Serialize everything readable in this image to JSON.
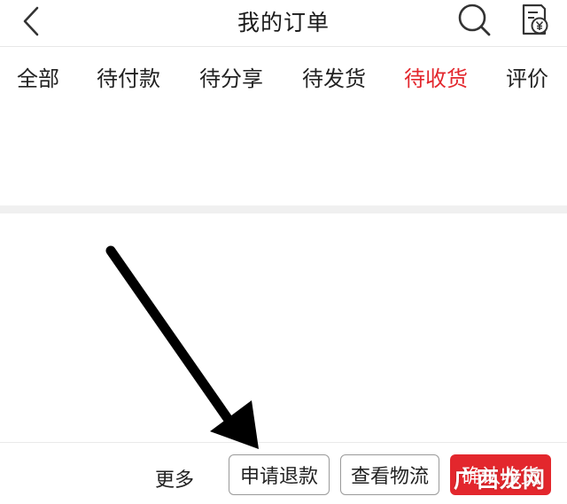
{
  "header": {
    "back_icon": "chevron-left-icon",
    "title": "我的订单",
    "search_icon": "search-icon",
    "receipt_icon": "receipt-yen-icon"
  },
  "tabs": [
    {
      "label": "全部",
      "active": false
    },
    {
      "label": "待付款",
      "active": false
    },
    {
      "label": "待分享",
      "active": false
    },
    {
      "label": "待发货",
      "active": false
    },
    {
      "label": "待收货",
      "active": true
    },
    {
      "label": "评价",
      "active": false
    }
  ],
  "footer": {
    "more_label": "更多",
    "refund_label": "申请退款",
    "logistics_label": "查看物流",
    "confirm_label": "确认收货"
  },
  "watermark": "广西龙网",
  "colors": {
    "accent": "#e3272d",
    "text": "#222222",
    "divider": "#e9e9e9",
    "section_gap": "#f0f0f0"
  }
}
